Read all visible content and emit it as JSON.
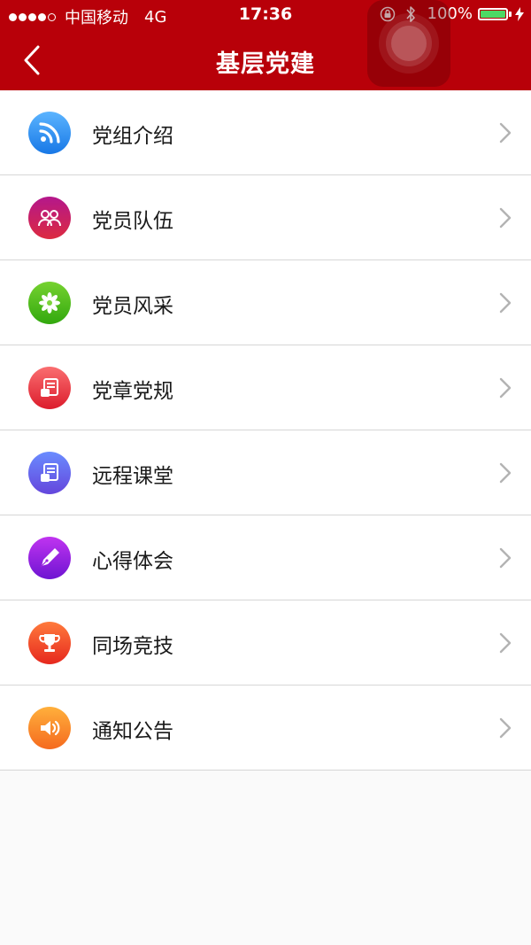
{
  "status_bar": {
    "carrier": "中国移动",
    "network": "4G",
    "time": "17:36",
    "battery_percent": "100%",
    "battery_color": "#4cd964",
    "signal_bars_filled": 4,
    "signal_bars_total": 5
  },
  "header": {
    "title": "基层党建",
    "background_color": "#b80009",
    "back_icon": "chevron-left-icon"
  },
  "menu": {
    "items": [
      {
        "label": "党组介绍",
        "icon": "rss-icon",
        "color_top": "#5bb4ff",
        "color_bottom": "#1878e6"
      },
      {
        "label": "党员队伍",
        "icon": "team-icon",
        "color_top": "#b4178c",
        "color_bottom": "#dc2a40"
      },
      {
        "label": "党员风采",
        "icon": "flower-icon",
        "color_top": "#76d230",
        "color_bottom": "#32a80e"
      },
      {
        "label": "党章党规",
        "icon": "document-icon",
        "color_top": "#fa6e70",
        "color_bottom": "#dc1c2c"
      },
      {
        "label": "远程课堂",
        "icon": "classroom-icon",
        "color_top": "#6a8cff",
        "color_bottom": "#6446dc"
      },
      {
        "label": "心得体会",
        "icon": "pen-icon",
        "color_top": "#c034f0",
        "color_bottom": "#6e14d2"
      },
      {
        "label": "同场竞技",
        "icon": "trophy-icon",
        "color_top": "#ff7a3c",
        "color_bottom": "#e6281e"
      },
      {
        "label": "通知公告",
        "icon": "speaker-icon",
        "color_top": "#ffb03c",
        "color_bottom": "#f56a1e"
      }
    ]
  }
}
